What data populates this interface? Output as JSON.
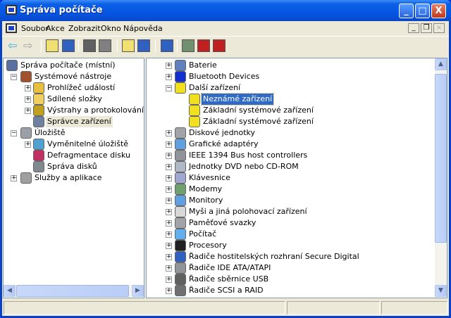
{
  "window": {
    "title": "Správa počítače",
    "buttons": {
      "minimize": "_",
      "maximize": "□",
      "close": "X"
    }
  },
  "menu": [
    "Soubor",
    "Akce",
    "Zobrazit",
    "Okno",
    "Nápověda"
  ],
  "toolbar": [
    "back-icon",
    "forward-icon",
    "up-folder-icon",
    "show-hide-tree-icon",
    "properties-icon",
    "print-icon",
    "help-icon",
    "show-action-pane-icon",
    "scan-hardware-icon",
    "update-driver-icon",
    "uninstall-icon",
    "disable-icon"
  ],
  "left_tree": [
    {
      "label": "Správa počítače (místní)",
      "level": 0,
      "exp": "",
      "icon": "computer-icon",
      "color": "#5a6fa0"
    },
    {
      "label": "Systémové nástroje",
      "level": 1,
      "exp": "-",
      "icon": "tools-icon",
      "color": "#a0522d"
    },
    {
      "label": "Prohlížeč událostí",
      "level": 2,
      "exp": "+",
      "icon": "event-viewer-icon",
      "color": "#e8c040"
    },
    {
      "label": "Sdílené složky",
      "level": 2,
      "exp": "+",
      "icon": "shared-folder-icon",
      "color": "#f0d060"
    },
    {
      "label": "Výstrahy a protokolování výkonu",
      "level": 2,
      "exp": "+",
      "icon": "alerts-icon",
      "color": "#c0a020"
    },
    {
      "label": "Správce zařízení",
      "level": 2,
      "exp": "",
      "icon": "device-manager-icon",
      "color": "#7080a0",
      "insel": true
    },
    {
      "label": "Úložiště",
      "level": 1,
      "exp": "-",
      "icon": "storage-icon",
      "color": "#9aa0a8"
    },
    {
      "label": "Vyměnitelné úložiště",
      "level": 2,
      "exp": "+",
      "icon": "removable-storage-icon",
      "color": "#50a0d0"
    },
    {
      "label": "Defragmentace disku",
      "level": 2,
      "exp": "",
      "icon": "defrag-icon",
      "color": "#c03060"
    },
    {
      "label": "Správa disků",
      "level": 2,
      "exp": "",
      "icon": "disk-management-icon",
      "color": "#808890"
    },
    {
      "label": "Služby a aplikace",
      "level": 1,
      "exp": "+",
      "icon": "services-icon",
      "color": "#a0a0a0"
    }
  ],
  "device_tree": [
    {
      "label": "Baterie",
      "level": 0,
      "exp": "+",
      "icon": "battery-icon",
      "color": "#6080c0"
    },
    {
      "label": "Bluetooth Devices",
      "level": 0,
      "exp": "+",
      "icon": "bluetooth-icon",
      "color": "#1030d0"
    },
    {
      "label": "Další zařízení",
      "level": 0,
      "exp": "-",
      "icon": "other-devices-icon",
      "color": "#f0e020"
    },
    {
      "label": "Neznámé zařízení",
      "level": 1,
      "exp": "",
      "icon": "unknown-device-icon",
      "color": "#f0e020",
      "sel": true
    },
    {
      "label": "Základní systémové zařízení",
      "level": 1,
      "exp": "",
      "icon": "unknown-device-icon",
      "color": "#f0e020"
    },
    {
      "label": "Základní systémové zařízení",
      "level": 1,
      "exp": "",
      "icon": "unknown-device-icon",
      "color": "#f0e020"
    },
    {
      "label": "Diskové jednotky",
      "level": 0,
      "exp": "+",
      "icon": "disk-drive-icon",
      "color": "#a0a4a8"
    },
    {
      "label": "Grafické adaptéry",
      "level": 0,
      "exp": "+",
      "icon": "display-adapter-icon",
      "color": "#60a0e0"
    },
    {
      "label": "IEEE 1394 Bus host controllers",
      "level": 0,
      "exp": "+",
      "icon": "ieee1394-icon",
      "color": "#909498"
    },
    {
      "label": "Jednotky DVD nebo CD-ROM",
      "level": 0,
      "exp": "+",
      "icon": "dvd-icon",
      "color": "#b0b8c8"
    },
    {
      "label": "Klávesnice",
      "level": 0,
      "exp": "+",
      "icon": "keyboard-icon",
      "color": "#a0a8d0"
    },
    {
      "label": "Modemy",
      "level": 0,
      "exp": "+",
      "icon": "modem-icon",
      "color": "#70a070"
    },
    {
      "label": "Monitory",
      "level": 0,
      "exp": "+",
      "icon": "monitor-icon",
      "color": "#60a0e0"
    },
    {
      "label": "Myši a jiná polohovací zařízení",
      "level": 0,
      "exp": "+",
      "icon": "mouse-icon",
      "color": "#d8d8d8"
    },
    {
      "label": "Paměťové svazky",
      "level": 0,
      "exp": "+",
      "icon": "storage-volume-icon",
      "color": "#a0a4a8"
    },
    {
      "label": "Počítač",
      "level": 0,
      "exp": "+",
      "icon": "computer-icon",
      "color": "#60b0f0"
    },
    {
      "label": "Procesory",
      "level": 0,
      "exp": "+",
      "icon": "processor-icon",
      "color": "#202020"
    },
    {
      "label": "Řadiče hostitelských rozhraní Secure Digital",
      "level": 0,
      "exp": "+",
      "icon": "sd-host-icon",
      "color": "#3060c0"
    },
    {
      "label": "Řadiče IDE ATA/ATAPI",
      "level": 0,
      "exp": "+",
      "icon": "ide-icon",
      "color": "#909498"
    },
    {
      "label": "Řadiče sběrnice USB",
      "level": 0,
      "exp": "+",
      "icon": "usb-icon",
      "color": "#606060"
    },
    {
      "label": "Řadiče SCSI a RAID",
      "level": 0,
      "exp": "+",
      "icon": "scsi-icon",
      "color": "#707070"
    }
  ]
}
